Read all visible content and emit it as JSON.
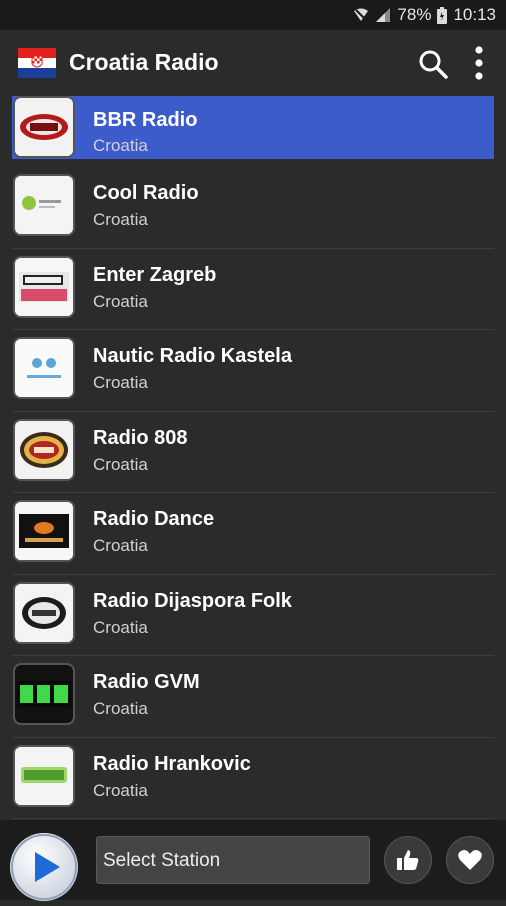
{
  "status": {
    "battery": "78%",
    "time": "10:13"
  },
  "app": {
    "title": "Croatia Radio",
    "flag_icon": "croatia-flag-icon"
  },
  "stations": [
    {
      "name": "BBR Radio",
      "country": "Croatia",
      "selected": true
    },
    {
      "name": "Cool Radio",
      "country": "Croatia"
    },
    {
      "name": "Enter Zagreb",
      "country": "Croatia"
    },
    {
      "name": "Nautic Radio Kastela",
      "country": "Croatia"
    },
    {
      "name": "Radio 808",
      "country": "Croatia"
    },
    {
      "name": "Radio Dance",
      "country": "Croatia"
    },
    {
      "name": "Radio Dijaspora Folk",
      "country": "Croatia"
    },
    {
      "name": "Radio GVM",
      "country": "Croatia"
    },
    {
      "name": "Radio Hrankovic",
      "country": "Croatia"
    }
  ],
  "player": {
    "select_label": "Select Station"
  },
  "colors": {
    "selected": "#3d5ccb",
    "background": "#2b2b2b",
    "play": "#1f6ad6"
  }
}
